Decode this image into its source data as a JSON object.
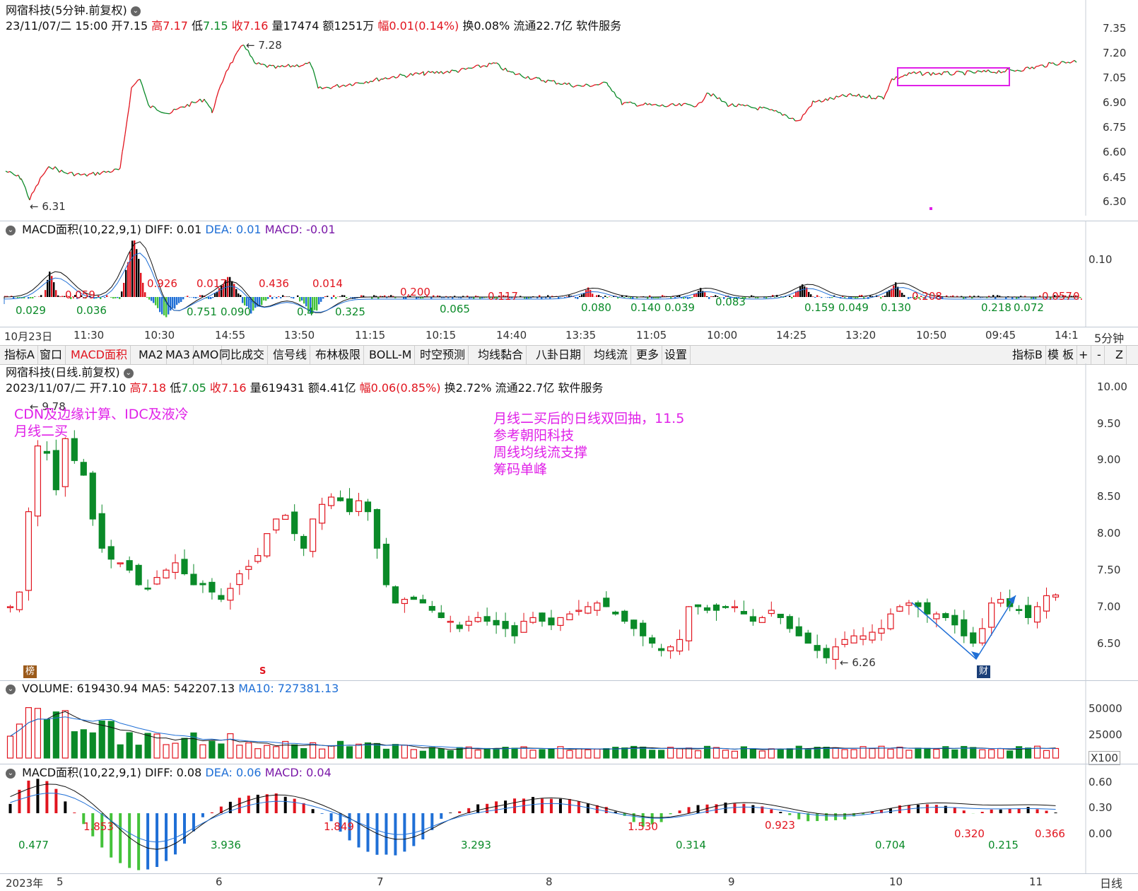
{
  "intraday": {
    "title": "网宿科技(5分钟.前复权)",
    "info": {
      "datetime": "23/11/07/二 15:00",
      "open_label": "开",
      "open": "7.15",
      "high_label": "高",
      "high": "7.17",
      "low_label": "低",
      "low": "7.15",
      "close_label": "收",
      "close": "7.16",
      "vol_label": "量",
      "vol": "17474",
      "amt_label": "额",
      "amt": "1251万",
      "chg_label": "幅",
      "chg": "0.01(0.14%)",
      "turnover": "换0.08%",
      "float": "流通22.7亿",
      "industry": "软件服务"
    },
    "y_ticks": [
      "7.35",
      "7.20",
      "7.05",
      "6.90",
      "6.75",
      "6.60",
      "6.45",
      "6.30"
    ],
    "high_mark": "7.28",
    "low_mark": "6.31",
    "macd": {
      "name": "MACD面积(10,22,9,1)",
      "diff": "DIFF: 0.01",
      "dea": "DEA: 0.01",
      "macd": "MACD: -0.01",
      "y_tick": "0.10",
      "labels": [
        "0.029",
        "0.036",
        "0.059",
        "0.926",
        "0.751",
        "0.017",
        "0.090",
        "0.436",
        "0.4",
        "0.325",
        "0.014",
        "0.200",
        "0.065",
        "0.117",
        "0.080",
        "0.140",
        "0.039",
        "0.083",
        "0.159",
        "0.049",
        "0.130",
        "0.208",
        "0.218",
        "0.072",
        "0.057",
        "0."
      ]
    },
    "time_ticks": [
      "10月23日",
      "11:30",
      "10:30",
      "14:55",
      "13:50",
      "11:15",
      "10:15",
      "14:40",
      "13:35",
      "11:05",
      "10:00",
      "14:25",
      "13:20",
      "10:50",
      "09:45",
      "14:1"
    ],
    "period": "5分钟"
  },
  "toolbar": {
    "items": [
      "指标A",
      "窗口",
      "MACD面积",
      "MA2",
      "MA3",
      "AMO",
      "同比成交",
      "信号线",
      "布林极限",
      "BOLL-M",
      "时空预测",
      "均线黏合",
      "八卦日期",
      "均线流",
      "更多",
      "设置"
    ],
    "right_items": [
      "指标B",
      "模 板",
      "+",
      "-",
      "Z"
    ]
  },
  "daily": {
    "title": "网宿科技(日线.前复权)",
    "info": {
      "datetime": "2023/11/07/二",
      "open_label": "开",
      "open": "7.10",
      "high_label": "高",
      "high": "7.18",
      "low_label": "低",
      "low": "7.05",
      "close_label": "收",
      "close": "7.16",
      "vol_label": "量",
      "vol": "619431",
      "amt_label": "额",
      "amt": "4.41亿",
      "chg_label": "幅",
      "chg": "0.06(0.85%)",
      "turnover": "换2.72%",
      "float": "流通22.7亿",
      "industry": "软件服务"
    },
    "y_ticks": [
      "10.00",
      "9.50",
      "9.00",
      "8.50",
      "8.00",
      "7.50",
      "7.00",
      "6.50"
    ],
    "high_mark": "9.78",
    "low_mark": "6.26",
    "notes_left": [
      "CDN及边缘计算、IDC及液冷",
      "月线二买"
    ],
    "notes_mid": [
      "月线二买后的日线双回抽，11.5",
      "参考朝阳科技",
      "周线均线流支撑",
      "筹码单峰"
    ],
    "badges": {
      "bang": "榜",
      "s": "S",
      "cai": "财"
    },
    "volume": {
      "name": "VOLUME: 619430.94",
      "ma5": "MA5: 542207.13",
      "ma10": "MA10: 727381.13",
      "y_ticks": [
        "50000",
        "25000"
      ],
      "unit": "X100"
    },
    "macd": {
      "name": "MACD面积(10,22,9,1)",
      "diff": "DIFF: 0.08",
      "dea": "DEA: 0.06",
      "macd": "MACD: 0.04",
      "y_ticks": [
        "0.60",
        "0.30",
        "0.00"
      ],
      "labels": [
        "0.477",
        "1.853",
        "3.936",
        "1.849",
        "3.293",
        "1.530",
        "0.314",
        "0.923",
        "0.704",
        "0.320",
        "0.215",
        "0.366"
      ]
    },
    "x_ticks": [
      "2023年",
      "5",
      "6",
      "7",
      "8",
      "9",
      "10",
      "11"
    ],
    "period": "日线"
  },
  "colors": {
    "up": "#e1141e",
    "down": "#0a8a28",
    "blue": "#1f6fd6",
    "magenta": "#e020e8"
  },
  "chart_data": [
    {
      "type": "line",
      "title": "网宿科技(5分钟.前复权)",
      "ylim": [
        6.28,
        7.38
      ],
      "annotations": [
        {
          "text": "7.28",
          "kind": "max"
        },
        {
          "text": "6.31",
          "kind": "min"
        }
      ]
    },
    {
      "type": "bar",
      "title": "网宿科技(日线.前复权)",
      "ylim": [
        6.2,
        10.05
      ],
      "x_ticks": [
        "5",
        "6",
        "7",
        "8",
        "9",
        "10",
        "11"
      ],
      "annotations": [
        {
          "text": "9.78",
          "kind": "max"
        },
        {
          "text": "6.26",
          "kind": "min"
        }
      ]
    }
  ]
}
